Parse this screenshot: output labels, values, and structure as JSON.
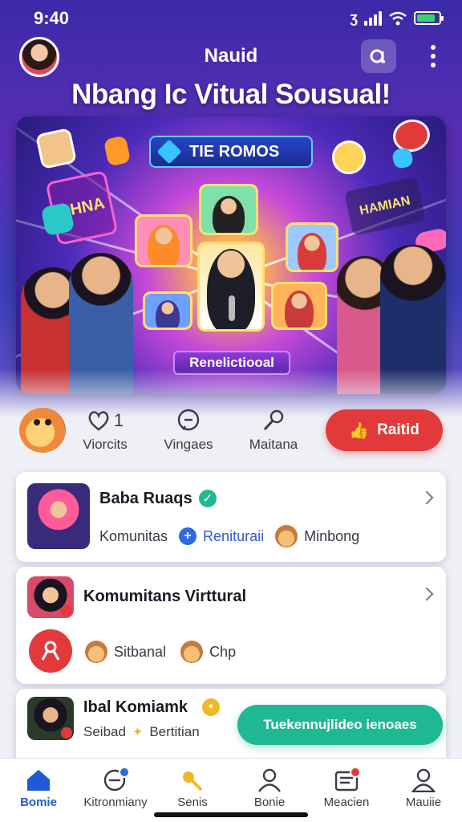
{
  "status": {
    "time": "9:40"
  },
  "header": {
    "title": "Nauid",
    "headline": "Nbang Ic Vitual Sousual!"
  },
  "banner": {
    "title": "TIE ROMOS",
    "cta": "Renelictiooal",
    "neon_left": "BHNA",
    "neon_right": "HAMIAN"
  },
  "actions": [
    {
      "label": "Viorcits",
      "count": "1"
    },
    {
      "label": "Vingaes"
    },
    {
      "label": "Maitana"
    }
  ],
  "rate_button": "Raitid",
  "cards": [
    {
      "title": "Baba Ruaqs",
      "meta": [
        "Komunitas",
        "Renituraii",
        "Minbong"
      ]
    },
    {
      "title": "Komumitans Virttural",
      "meta": [
        "Sitbanal",
        "Chp"
      ]
    },
    {
      "title": "Ibal Komiamk",
      "meta": [
        "Seibad",
        "Bertitian"
      ]
    }
  ],
  "join_button": "Tuekennujlideo ienoaes",
  "nav": [
    {
      "label": "Bomie",
      "icon": "home-icon"
    },
    {
      "label": "Kitronmiany",
      "icon": "chat-icon"
    },
    {
      "label": "Senis",
      "icon": "key-icon"
    },
    {
      "label": "Bonie",
      "icon": "person-icon"
    },
    {
      "label": "Meacien",
      "icon": "media-icon"
    },
    {
      "label": "Mauiie",
      "icon": "profile-icon"
    }
  ],
  "colors": {
    "accent": "#e23a3a",
    "teal": "#1fb894",
    "nav_active": "#1f5ad6",
    "verified": "#1fb894"
  }
}
